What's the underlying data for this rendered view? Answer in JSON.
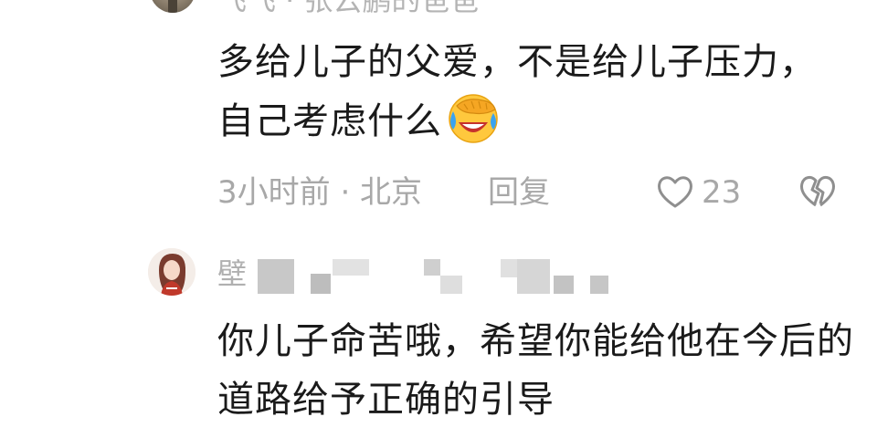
{
  "comment1": {
    "author_partial": "飞飞 · 张云鹏的爸爸",
    "text": "多给儿子的父爱，不是给儿子压力，自己考虑什么",
    "emoji_icon": "facepalm-laugh-emoji",
    "time_location": "3小时前 · 北京",
    "reply_label": "回复",
    "like_count": "23",
    "like_icon": "heart-outline-icon",
    "dislike_icon": "broken-heart-icon"
  },
  "comment2": {
    "author_visible": "壁",
    "text": "你儿子命苦哦，希望你能给他在今后的道路给予正确的引导"
  },
  "colors": {
    "text_primary": "#1a1a1a",
    "text_secondary": "#a8a8a8",
    "background": "#ffffff"
  }
}
